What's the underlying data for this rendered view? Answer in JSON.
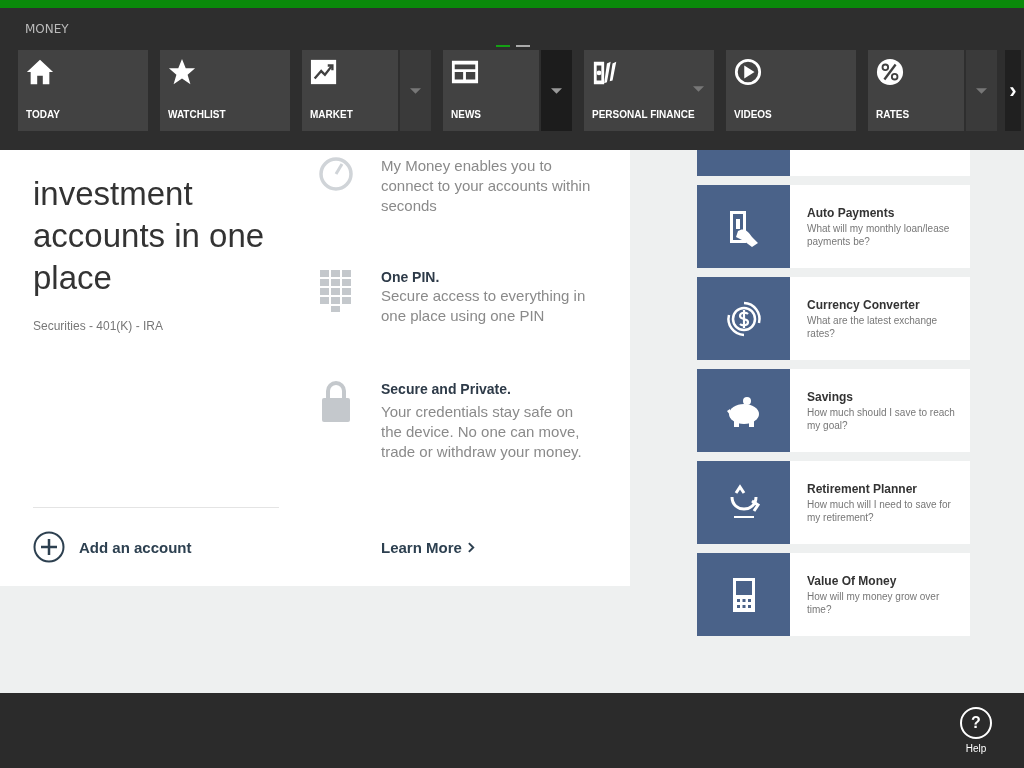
{
  "app_title": "MONEY",
  "page_indicator": [
    {
      "selected": true
    },
    {
      "selected": false
    }
  ],
  "nav": [
    {
      "label": "TODAY",
      "kind": "tile"
    },
    {
      "label": "WATCHLIST",
      "kind": "tile"
    },
    {
      "label": "MARKET",
      "kind": "split",
      "hovered": false
    },
    {
      "label": "NEWS",
      "kind": "split",
      "hovered": true
    },
    {
      "label": "PERSONAL FINANCE",
      "kind": "menu-tile"
    },
    {
      "label": "VIDEOS",
      "kind": "tile"
    },
    {
      "label": "RATES",
      "kind": "split",
      "hovered": false
    }
  ],
  "nav_more": "›",
  "hero": {
    "title": "investment accounts in one place",
    "subtitle": "Securities - 401(K) - IRA",
    "add_account": "Add an account"
  },
  "features": [
    {
      "text": "My Money enables you to connect to your accounts within seconds"
    },
    {
      "title": "One PIN.",
      "text": "Secure access to everything in one place using one PIN"
    },
    {
      "title": "Secure and Private.",
      "text": "Your credentials stay safe on the device. No one can move, trade or withdraw your money."
    }
  ],
  "learn_more": "Learn More",
  "tools": [
    {
      "title": "Auto Payments",
      "description": "What will my monthly loan/lease payments be?"
    },
    {
      "title": "Currency Converter",
      "description": "What are the latest exchange rates?"
    },
    {
      "title": "Savings",
      "description": "How much should I save to reach my goal?"
    },
    {
      "title": "Retirement Planner",
      "description": "How much will I need to save for my retirement?"
    },
    {
      "title": "Value Of Money",
      "description": "How will my money grow over time?"
    }
  ],
  "help": {
    "symbol": "?",
    "label": "Help"
  }
}
